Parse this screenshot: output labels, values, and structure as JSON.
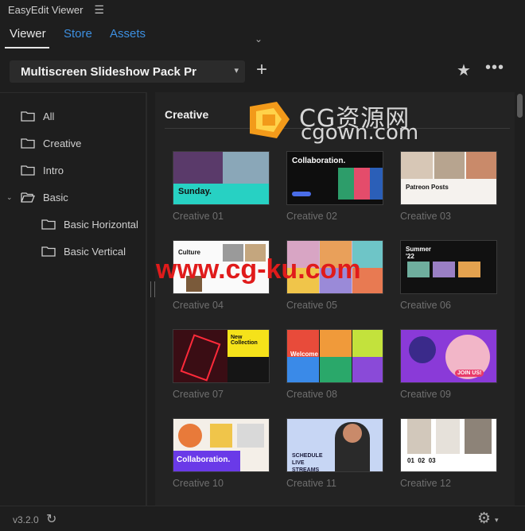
{
  "app": {
    "title": "EasyEdit Viewer",
    "menu_icon": "hamburger-icon"
  },
  "tabs": [
    {
      "label": "Viewer",
      "active": true
    },
    {
      "label": "Store",
      "active": false
    },
    {
      "label": "Assets",
      "active": false
    }
  ],
  "toolbar": {
    "pack_name": "Multiscreen Slideshow Pack Pr",
    "add_label": "+",
    "star_icon": "star-icon",
    "more_icon": "more-icon"
  },
  "sidebar": {
    "items": [
      {
        "label": "All"
      },
      {
        "label": "Creative"
      },
      {
        "label": "Intro"
      },
      {
        "label": "Basic",
        "expanded": true
      },
      {
        "label": "Basic Horizontal"
      },
      {
        "label": "Basic Vertical"
      }
    ]
  },
  "main": {
    "section_title": "Creative",
    "cards": [
      {
        "label": "Creative 01",
        "thumb_text": "Sunday."
      },
      {
        "label": "Creative 02",
        "thumb_text": "Collaboration."
      },
      {
        "label": "Creative 03",
        "thumb_text": "Patreon Posts"
      },
      {
        "label": "Creative 04",
        "thumb_text": "Culture"
      },
      {
        "label": "Creative 05",
        "thumb_text": ""
      },
      {
        "label": "Creative 06",
        "thumb_text": "Summer '22"
      },
      {
        "label": "Creative 07",
        "thumb_text": "New Collection"
      },
      {
        "label": "Creative 08",
        "thumb_text": "Welcome"
      },
      {
        "label": "Creative 09",
        "thumb_text": "JOIN US!"
      },
      {
        "label": "Creative 10",
        "thumb_text": "Collaboration."
      },
      {
        "label": "Creative 11",
        "thumb_text": "SCHEDULE LIVE STREAMS"
      },
      {
        "label": "Creative 12",
        "thumb_text": "01  02  03"
      }
    ]
  },
  "watermarks": {
    "cn": "CG资源网",
    "en": "cgown.com",
    "red": "www.cg-ku.com"
  },
  "status": {
    "version": "v3.2.0"
  },
  "colors": {
    "accent": "#3d8fe0",
    "background": "#1e1e1e",
    "panel": "#232323"
  }
}
